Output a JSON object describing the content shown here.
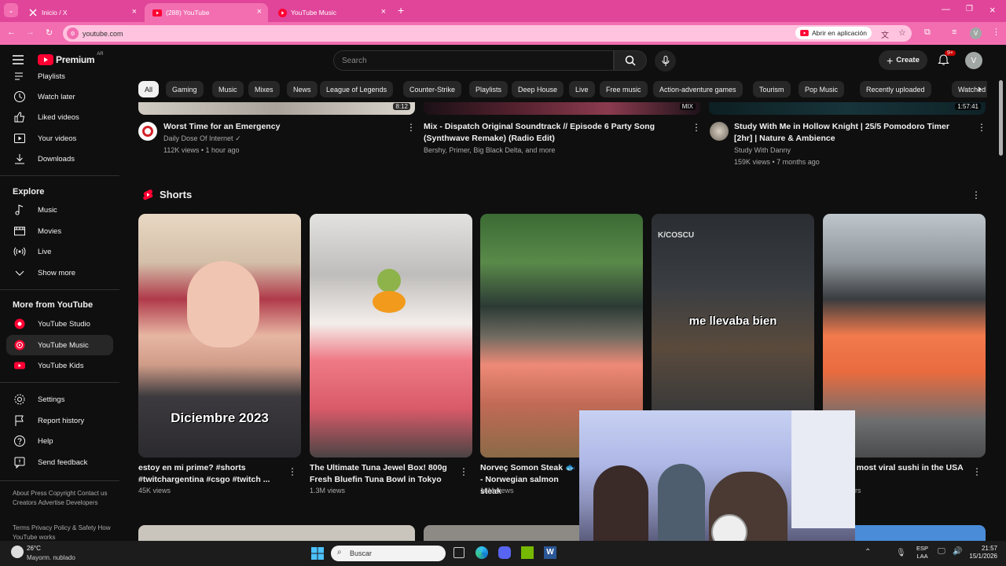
{
  "browser": {
    "tabs": [
      {
        "label": "Inicio / X"
      },
      {
        "label": "(288) YouTube"
      },
      {
        "label": "YouTube Music"
      }
    ],
    "url": "youtube.com",
    "open_app_label": "Abrir en aplicación",
    "profile_initial": "V"
  },
  "yt": {
    "logo_text": "Premium",
    "region": "AR",
    "search_placeholder": "Search",
    "create_label": "Create",
    "notif_badge": "9+",
    "avatar_initial": "V"
  },
  "sidebar": {
    "top_items": [
      {
        "label": "Playlists",
        "icon": "playlists-icon"
      },
      {
        "label": "Watch later",
        "icon": "clock-icon"
      },
      {
        "label": "Liked videos",
        "icon": "thumb-up-icon"
      },
      {
        "label": "Your videos",
        "icon": "play-square-icon"
      },
      {
        "label": "Downloads",
        "icon": "download-icon"
      }
    ],
    "explore_heading": "Explore",
    "explore_items": [
      {
        "label": "Music",
        "icon": "music-note-icon"
      },
      {
        "label": "Movies",
        "icon": "film-icon"
      },
      {
        "label": "Live",
        "icon": "live-icon"
      },
      {
        "label": "Show more",
        "icon": "chevron-down-icon"
      }
    ],
    "more_heading": "More from YouTube",
    "more_items": [
      {
        "label": "YouTube Studio"
      },
      {
        "label": "YouTube Music"
      },
      {
        "label": "YouTube Kids"
      }
    ],
    "settings_items": [
      {
        "label": "Settings",
        "icon": "gear-icon"
      },
      {
        "label": "Report history",
        "icon": "flag-icon"
      },
      {
        "label": "Help",
        "icon": "help-icon"
      },
      {
        "label": "Send feedback",
        "icon": "feedback-icon"
      }
    ],
    "footer1": "About  Press  Copyright  Contact us  Creators  Advertise  Developers",
    "footer2": "Terms  Privacy  Policy & Safety  How YouTube works"
  },
  "chips": [
    "All",
    "Gaming",
    "Music",
    "Mixes",
    "News",
    "League of Legends",
    "Counter-Strike",
    "Playlists",
    "Deep House",
    "Live",
    "Free music",
    "Action-adventure games",
    "Tourism",
    "Pop Music",
    "Recently uploaded",
    "Watched"
  ],
  "videos": [
    {
      "title": "Worst Time for an Emergency",
      "channel": "Daily Dose Of Internet",
      "meta": "112K views • 1 hour ago",
      "duration": "8:12"
    },
    {
      "title": "Mix - Dispatch Original Soundtrack // Episode 6 Party Song (Synthwave Remake) (Radio Edit)",
      "channel": "Bershy, Primer, Big Black Delta, and more",
      "meta": "",
      "badge": "MIX"
    },
    {
      "title": "Study With Me in Hollow Knight | 25/5 Pomodoro Timer [2hr] | Nature & Ambience",
      "channel": "Study With Danny",
      "meta": "159K views • 7 months ago",
      "duration": "1:57:41"
    }
  ],
  "shorts_heading": "Shorts",
  "shorts": [
    {
      "title": "estoy en mi prime? #shorts #twitchargentina #csgo #twitch ...",
      "views": "45K views",
      "overlay": "Diciembre 2023"
    },
    {
      "title": "The Ultimate Tuna Jewel Box! 800g Fresh Bluefin Tuna Bowl in Tokyo",
      "views": "1.3M views"
    },
    {
      "title": "Norveç Somon Steak 🐟 - Norwegian salmon steak",
      "views": "16M views"
    },
    {
      "title": "",
      "views": "",
      "overlay": "me llevaba bien",
      "watermark": "K/COSCU"
    },
    {
      "title": "e most viral sushi in the USA",
      "views": "rs"
    }
  ],
  "taskbar": {
    "weather_temp": "26°C",
    "weather_desc": "Mayorm. nublado",
    "search_label": "Buscar",
    "lang1": "ESP",
    "lang2": "LAA",
    "time": "21:57",
    "date": "15/1/2026"
  },
  "colors": {
    "chrome_pink": "#e0459a",
    "yt_red": "#ff0033",
    "bg": "#0f0f0f"
  }
}
